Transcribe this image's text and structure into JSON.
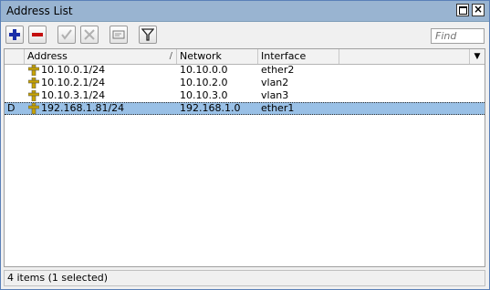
{
  "window": {
    "title": "Address List"
  },
  "toolbar": {
    "find_placeholder": "Find",
    "add_color": "#1a2fa8",
    "remove_color": "#c41010"
  },
  "columns": [
    "Address",
    "Network",
    "Interface"
  ],
  "sort_indicator": "/",
  "rows": [
    {
      "flag": "",
      "address": "10.10.0.1/24",
      "network": "10.10.0.0",
      "interface": "ether2",
      "selected": false
    },
    {
      "flag": "",
      "address": "10.10.2.1/24",
      "network": "10.10.2.0",
      "interface": "vlan2",
      "selected": false
    },
    {
      "flag": "",
      "address": "10.10.3.1/24",
      "network": "10.10.3.0",
      "interface": "vlan3",
      "selected": false
    },
    {
      "flag": "D",
      "address": "192.168.1.81/24",
      "network": "192.168.1.0",
      "interface": "ether1",
      "selected": true
    }
  ],
  "status": {
    "text": "4 items (1 selected)"
  }
}
